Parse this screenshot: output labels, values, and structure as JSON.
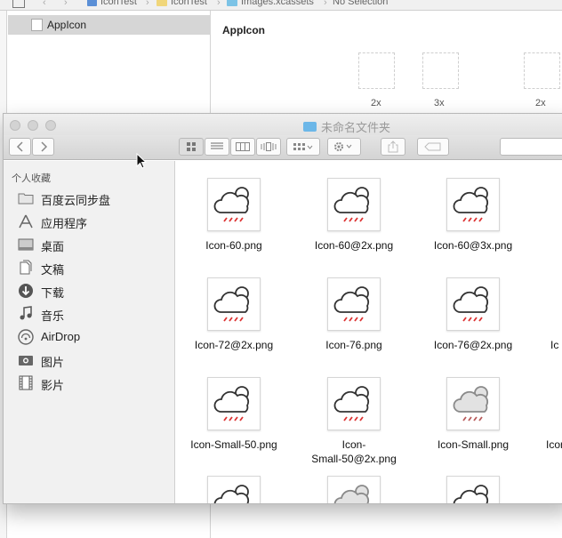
{
  "xcode": {
    "breadcrumb": [
      "IconTest",
      "IconTest",
      "Images.xcassets",
      "No Selection"
    ],
    "navigator_item": "AppIcon",
    "editor_title": "AppIcon",
    "slots": [
      "2x",
      "3x",
      "2x"
    ]
  },
  "finder": {
    "title": "未命名文件夹",
    "sidebar_header": "个人收藏",
    "sidebar_items": [
      {
        "label": "百度云同步盘",
        "icon": "folder-icon"
      },
      {
        "label": "应用程序",
        "icon": "applications-icon"
      },
      {
        "label": "桌面",
        "icon": "desktop-icon"
      },
      {
        "label": "文稿",
        "icon": "documents-icon"
      },
      {
        "label": "下载",
        "icon": "downloads-icon"
      },
      {
        "label": "音乐",
        "icon": "music-icon"
      },
      {
        "label": "AirDrop",
        "icon": "airdrop-icon"
      },
      {
        "label": "图片",
        "icon": "pictures-icon"
      },
      {
        "label": "影片",
        "icon": "movies-icon"
      }
    ],
    "files": [
      {
        "name": "Icon-60.png"
      },
      {
        "name": "Icon-60@2x.png"
      },
      {
        "name": "Icon-60@3x.png"
      },
      {
        "name": "Icon-72@2x.png"
      },
      {
        "name": "Icon-76.png"
      },
      {
        "name": "Icon-76@2x.png"
      },
      {
        "name": "Ic"
      },
      {
        "name": "Icon-Small-50.png"
      },
      {
        "name": "Icon-\nSmall-50@2x.png"
      },
      {
        "name": "Icon-Small.png"
      },
      {
        "name": "Icon"
      },
      {
        "name": ""
      },
      {
        "name": ""
      },
      {
        "name": ""
      }
    ]
  }
}
